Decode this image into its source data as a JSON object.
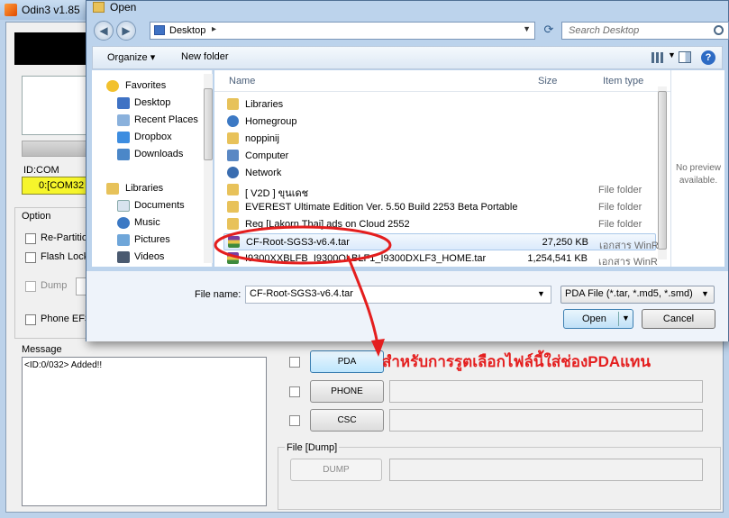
{
  "odin": {
    "title": "Odin3 v1.85",
    "idcom_label": "ID:COM",
    "com_value": "0:[COM32",
    "option_label": "Option",
    "options": [
      {
        "label": "Re-Partition"
      },
      {
        "label": "Flash Lock"
      },
      {
        "label": "Dump"
      },
      {
        "label": "Phone EFS"
      }
    ],
    "message_label": "Message",
    "message_text": "<ID:0/032> Added!!",
    "files": [
      {
        "label": "PDA"
      },
      {
        "label": "PHONE"
      },
      {
        "label": "CSC"
      }
    ],
    "file_dump_label": "File [Dump]",
    "dump_button": "DUMP"
  },
  "dialog": {
    "title": "Open",
    "address": "Desktop",
    "search_placeholder": "Search Desktop",
    "toolbar": {
      "organize": "Organize ▾",
      "new_folder": "New folder"
    },
    "nav": {
      "favorites": "Favorites",
      "fav_items": [
        "Desktop",
        "Recent Places",
        "Dropbox",
        "Downloads"
      ],
      "libraries": "Libraries",
      "lib_items": [
        "Documents",
        "Music",
        "Pictures",
        "Videos"
      ]
    },
    "columns": {
      "name": "Name",
      "size": "Size",
      "type": "Item type"
    },
    "files": [
      {
        "name": "Libraries",
        "size": "",
        "type": ""
      },
      {
        "name": "Homegroup",
        "size": "",
        "type": ""
      },
      {
        "name": "noppinij",
        "size": "",
        "type": ""
      },
      {
        "name": "Computer",
        "size": "",
        "type": ""
      },
      {
        "name": "Network",
        "size": "",
        "type": ""
      },
      {
        "name": "[ V2D ] ขุนเดช",
        "size": "",
        "type": "File folder"
      },
      {
        "name": "EVEREST Ultimate Edition Ver. 5.50 Build 2253 Beta Portable",
        "size": "",
        "type": "File folder"
      },
      {
        "name": "Reg [Lakorn Thai] ads on Cloud 2552",
        "size": "",
        "type": "File folder"
      },
      {
        "name": "CF-Root-SGS3-v6.4.tar",
        "size": "27,250 KB",
        "type": "เอกสาร WinR"
      },
      {
        "name": "I9300XXBLFB_I9300OLBLF1_I9300DXLF3_HOME.tar",
        "size": "1,254,541 KB",
        "type": "เอกสาร WinR"
      }
    ],
    "preview_text": "No preview available.",
    "filename_label": "File name:",
    "filename_value": "CF-Root-SGS3-v6.4.tar",
    "filetype_value": "PDA File (*.tar, *.md5, *.smd)",
    "open_button": "Open",
    "cancel_button": "Cancel"
  },
  "annotation": "สำหรับการรูตเลือกไฟล์นี้ใส่ช่องPDAแทน",
  "colors": {
    "annotation": "#e41e1e",
    "com_highlight": "#f6f52b",
    "dialog_frame": "#bcd3ec"
  }
}
